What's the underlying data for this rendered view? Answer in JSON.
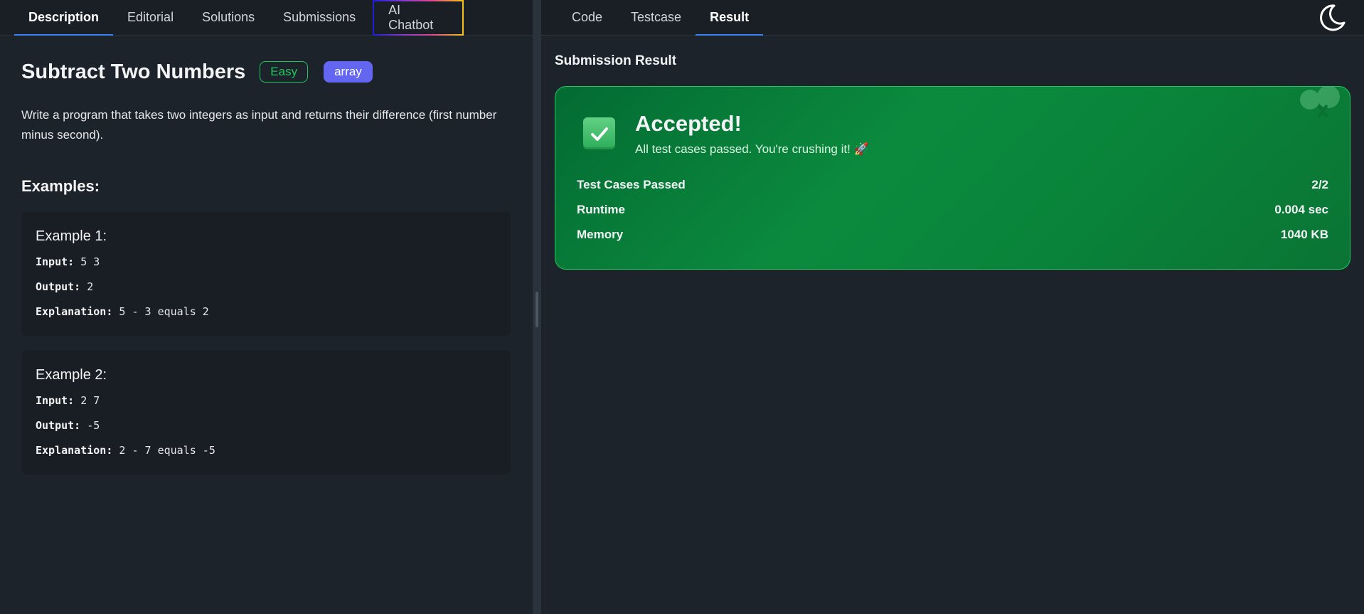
{
  "left_tabs": [
    {
      "label": "Description"
    },
    {
      "label": "Editorial"
    },
    {
      "label": "Solutions"
    },
    {
      "label": "Submissions"
    },
    {
      "label": "AI Chatbot"
    }
  ],
  "problem": {
    "title": "Subtract Two Numbers",
    "difficulty": "Easy",
    "tag": "array",
    "description": "Write a program that takes two integers as input and returns their difference (first number minus second).",
    "examples_heading": "Examples:",
    "examples": [
      {
        "title": "Example 1:",
        "input_label": "Input:",
        "input": "5 3",
        "output_label": "Output:",
        "output": "2",
        "explanation_label": "Explanation:",
        "explanation": "5 - 3 equals 2"
      },
      {
        "title": "Example 2:",
        "input_label": "Input:",
        "input": "2 7",
        "output_label": "Output:",
        "output": "-5",
        "explanation_label": "Explanation:",
        "explanation": "2 - 7 equals -5"
      }
    ]
  },
  "right_tabs": [
    {
      "label": "Code"
    },
    {
      "label": "Testcase"
    },
    {
      "label": "Result"
    }
  ],
  "result": {
    "heading": "Submission Result",
    "status": "Accepted!",
    "message": "All test cases passed. You're crushing it! 🚀",
    "stats": [
      {
        "label": "Test Cases Passed",
        "value": "2/2"
      },
      {
        "label": "Runtime",
        "value": "0.004 sec"
      },
      {
        "label": "Memory",
        "value": "1040 KB"
      }
    ]
  },
  "colors": {
    "accent": "#3b82f6",
    "easy": "#22c55e",
    "tag": "#6366f1",
    "success_card": "#0b8a3e"
  },
  "icons": {
    "theme_toggle": "moon-icon",
    "status": "check-icon"
  }
}
